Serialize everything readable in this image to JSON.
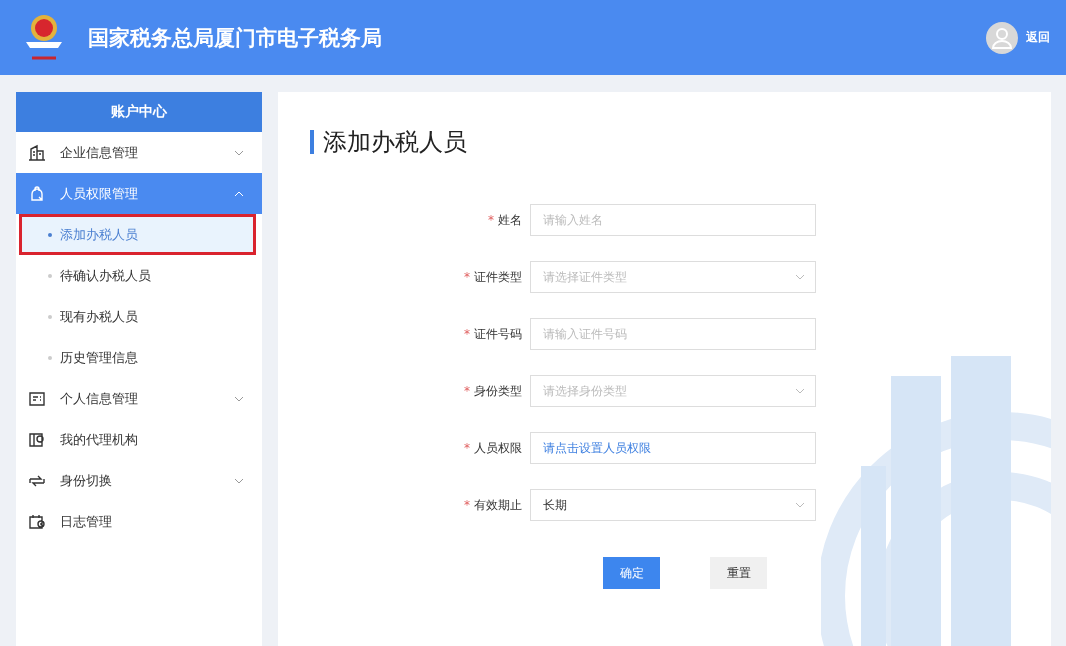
{
  "header": {
    "title": "国家税务总局厦门市电子税务局",
    "back": "返回"
  },
  "sidebar": {
    "title": "账户中心",
    "items": [
      {
        "kind": "group",
        "label": "企业信息管理",
        "expanded": false,
        "selected": false
      },
      {
        "kind": "group",
        "label": "人员权限管理",
        "expanded": true,
        "selected": true,
        "children": [
          {
            "label": "添加办税人员",
            "selected": true,
            "annotated": true
          },
          {
            "label": "待确认办税人员",
            "selected": false,
            "annotated": false
          },
          {
            "label": "现有办税人员",
            "selected": false,
            "annotated": false
          },
          {
            "label": "历史管理信息",
            "selected": false,
            "annotated": false
          }
        ]
      },
      {
        "kind": "group",
        "label": "个人信息管理",
        "expanded": false,
        "selected": false
      },
      {
        "kind": "link",
        "label": "我的代理机构",
        "selected": false
      },
      {
        "kind": "group",
        "label": "身份切换",
        "expanded": false,
        "selected": false
      },
      {
        "kind": "link",
        "label": "日志管理",
        "selected": false
      }
    ]
  },
  "page": {
    "title": "添加办税人员",
    "fields": [
      {
        "kind": "input",
        "required": "*",
        "label": "姓名",
        "placeholder": "请输入姓名"
      },
      {
        "kind": "select",
        "required": "*",
        "label": "证件类型",
        "placeholder": "请选择证件类型"
      },
      {
        "kind": "input",
        "required": "*",
        "label": "证件号码",
        "placeholder": "请输入证件号码"
      },
      {
        "kind": "select",
        "required": "*",
        "label": "身份类型",
        "placeholder": "请选择身份类型"
      },
      {
        "kind": "link",
        "required": "*",
        "label": "人员权限",
        "value": "请点击设置人员权限"
      },
      {
        "kind": "select",
        "required": "*",
        "label": "有效期止",
        "value": "长期"
      }
    ],
    "buttons": [
      {
        "kind": "primary",
        "label": "确定"
      },
      {
        "kind": "default",
        "label": "重置"
      }
    ]
  }
}
